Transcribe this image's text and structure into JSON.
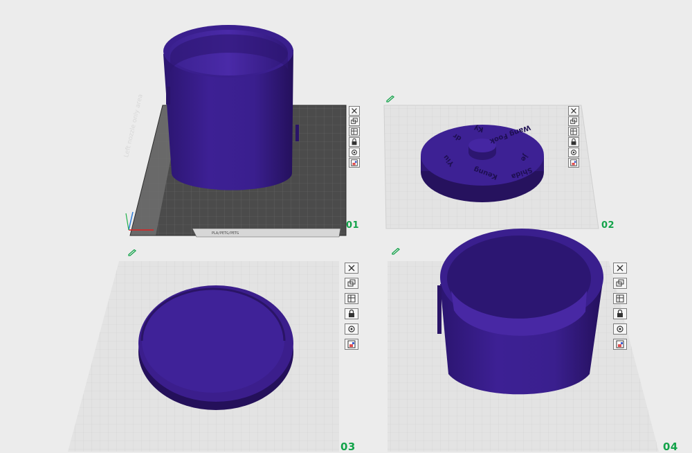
{
  "plates": [
    {
      "id": "plate-1",
      "label": "01",
      "active": true
    },
    {
      "id": "plate-2",
      "label": "02",
      "active": false
    },
    {
      "id": "plate-3",
      "label": "03",
      "active": false
    },
    {
      "id": "plate-4",
      "label": "04",
      "active": false
    }
  ],
  "bed": {
    "nozzle_area_text": "Left nozzle only area",
    "filament_strip_text": "PLA/PETG/PETG"
  },
  "lid": {
    "engraving_words": [
      "dr",
      "Ky",
      "Wang Fook",
      "je",
      "Shida",
      "Keung",
      "Yiu"
    ]
  },
  "plate_tools": [
    "close-icon",
    "arrange-icon",
    "layers-icon",
    "lock-icon",
    "settings-icon",
    "slice-icon"
  ],
  "colors": {
    "model": "#3b1e8c",
    "model_dark": "#26125e",
    "plate_label": "#13a34a",
    "bed_active": "#4a4a4a",
    "bed_inactive": "#e0e0e0"
  }
}
